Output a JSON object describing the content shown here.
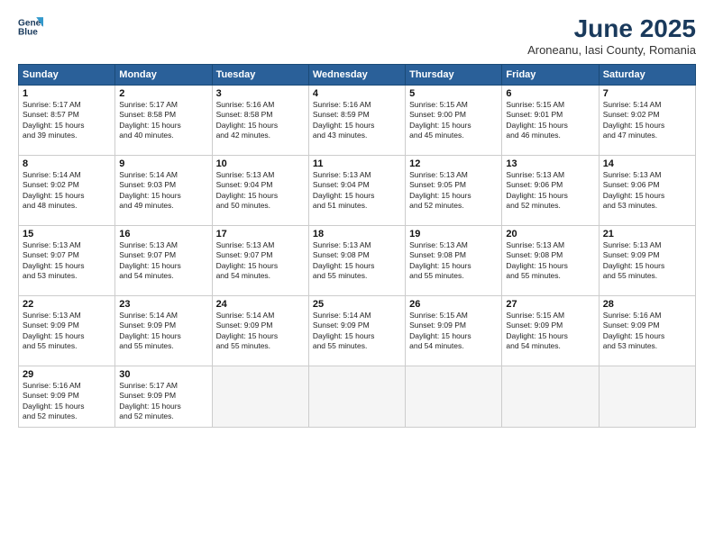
{
  "logo": {
    "line1": "General",
    "line2": "Blue"
  },
  "title": "June 2025",
  "subtitle": "Aroneanu, Iasi County, Romania",
  "weekdays": [
    "Sunday",
    "Monday",
    "Tuesday",
    "Wednesday",
    "Thursday",
    "Friday",
    "Saturday"
  ],
  "weeks": [
    [
      {
        "num": "1",
        "sr": "5:17 AM",
        "ss": "8:57 PM",
        "dl": "15 hours and 39 minutes."
      },
      {
        "num": "2",
        "sr": "5:17 AM",
        "ss": "8:58 PM",
        "dl": "15 hours and 40 minutes."
      },
      {
        "num": "3",
        "sr": "5:16 AM",
        "ss": "8:58 PM",
        "dl": "15 hours and 42 minutes."
      },
      {
        "num": "4",
        "sr": "5:16 AM",
        "ss": "8:59 PM",
        "dl": "15 hours and 43 minutes."
      },
      {
        "num": "5",
        "sr": "5:15 AM",
        "ss": "9:00 PM",
        "dl": "15 hours and 45 minutes."
      },
      {
        "num": "6",
        "sr": "5:15 AM",
        "ss": "9:01 PM",
        "dl": "15 hours and 46 minutes."
      },
      {
        "num": "7",
        "sr": "5:14 AM",
        "ss": "9:02 PM",
        "dl": "15 hours and 47 minutes."
      }
    ],
    [
      {
        "num": "8",
        "sr": "5:14 AM",
        "ss": "9:02 PM",
        "dl": "15 hours and 48 minutes."
      },
      {
        "num": "9",
        "sr": "5:14 AM",
        "ss": "9:03 PM",
        "dl": "15 hours and 49 minutes."
      },
      {
        "num": "10",
        "sr": "5:13 AM",
        "ss": "9:04 PM",
        "dl": "15 hours and 50 minutes."
      },
      {
        "num": "11",
        "sr": "5:13 AM",
        "ss": "9:04 PM",
        "dl": "15 hours and 51 minutes."
      },
      {
        "num": "12",
        "sr": "5:13 AM",
        "ss": "9:05 PM",
        "dl": "15 hours and 52 minutes."
      },
      {
        "num": "13",
        "sr": "5:13 AM",
        "ss": "9:06 PM",
        "dl": "15 hours and 52 minutes."
      },
      {
        "num": "14",
        "sr": "5:13 AM",
        "ss": "9:06 PM",
        "dl": "15 hours and 53 minutes."
      }
    ],
    [
      {
        "num": "15",
        "sr": "5:13 AM",
        "ss": "9:07 PM",
        "dl": "15 hours and 53 minutes."
      },
      {
        "num": "16",
        "sr": "5:13 AM",
        "ss": "9:07 PM",
        "dl": "15 hours and 54 minutes."
      },
      {
        "num": "17",
        "sr": "5:13 AM",
        "ss": "9:07 PM",
        "dl": "15 hours and 54 minutes."
      },
      {
        "num": "18",
        "sr": "5:13 AM",
        "ss": "9:08 PM",
        "dl": "15 hours and 55 minutes."
      },
      {
        "num": "19",
        "sr": "5:13 AM",
        "ss": "9:08 PM",
        "dl": "15 hours and 55 minutes."
      },
      {
        "num": "20",
        "sr": "5:13 AM",
        "ss": "9:08 PM",
        "dl": "15 hours and 55 minutes."
      },
      {
        "num": "21",
        "sr": "5:13 AM",
        "ss": "9:09 PM",
        "dl": "15 hours and 55 minutes."
      }
    ],
    [
      {
        "num": "22",
        "sr": "5:13 AM",
        "ss": "9:09 PM",
        "dl": "15 hours and 55 minutes."
      },
      {
        "num": "23",
        "sr": "5:14 AM",
        "ss": "9:09 PM",
        "dl": "15 hours and 55 minutes."
      },
      {
        "num": "24",
        "sr": "5:14 AM",
        "ss": "9:09 PM",
        "dl": "15 hours and 55 minutes."
      },
      {
        "num": "25",
        "sr": "5:14 AM",
        "ss": "9:09 PM",
        "dl": "15 hours and 55 minutes."
      },
      {
        "num": "26",
        "sr": "5:15 AM",
        "ss": "9:09 PM",
        "dl": "15 hours and 54 minutes."
      },
      {
        "num": "27",
        "sr": "5:15 AM",
        "ss": "9:09 PM",
        "dl": "15 hours and 54 minutes."
      },
      {
        "num": "28",
        "sr": "5:16 AM",
        "ss": "9:09 PM",
        "dl": "15 hours and 53 minutes."
      }
    ],
    [
      {
        "num": "29",
        "sr": "5:16 AM",
        "ss": "9:09 PM",
        "dl": "15 hours and 52 minutes."
      },
      {
        "num": "30",
        "sr": "5:17 AM",
        "ss": "9:09 PM",
        "dl": "15 hours and 52 minutes."
      },
      null,
      null,
      null,
      null,
      null
    ]
  ],
  "labels": {
    "sunrise": "Sunrise:",
    "sunset": "Sunset:",
    "daylight": "Daylight:"
  }
}
